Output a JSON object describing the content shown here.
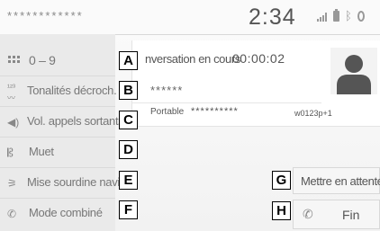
{
  "status_bar": {
    "caller_masked": "************",
    "clock": "2:34",
    "icons": [
      "signal-icon",
      "battery-icon",
      "bluetooth-icon",
      "connection-icon"
    ]
  },
  "menu": {
    "items": [
      {
        "label": "0 – 9",
        "icon": "keypad-icon"
      },
      {
        "label": "Tonalités décroch.",
        "icon": "tones-icon"
      },
      {
        "label": "Vol. appels sortants",
        "icon": "volume-icon"
      },
      {
        "label": "Muet",
        "icon": "mute-icon"
      },
      {
        "label": "Mise sourdine navi.",
        "icon": "navi-mute-icon"
      },
      {
        "label": "Mode combiné",
        "icon": "handset-icon"
      }
    ]
  },
  "call": {
    "status": "nversation en cours",
    "timer": "00:00:02",
    "contact_name": "******",
    "phone_type": "Portable",
    "phone_number": "**********",
    "line_id": "w0123p+1"
  },
  "buttons": {
    "hold": "Mettre en attente",
    "end": "Fin"
  },
  "callouts": [
    "A",
    "B",
    "C",
    "D",
    "E",
    "F",
    "G",
    "H"
  ],
  "colors": {
    "background": "#f2f2f2",
    "menu_background": "#eaeaea",
    "text": "#555555",
    "icon": "#888888"
  }
}
